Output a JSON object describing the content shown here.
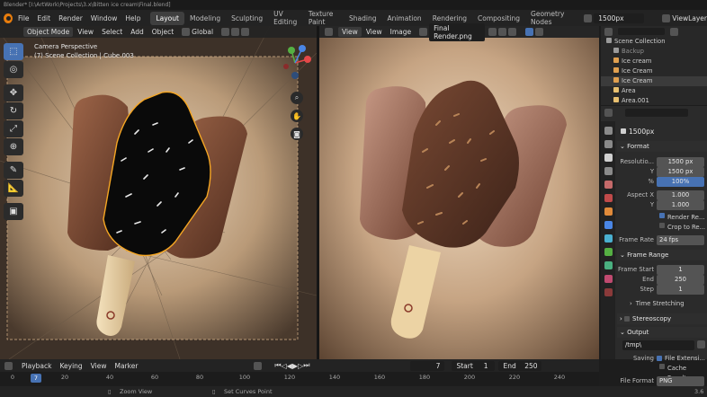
{
  "window": {
    "title": "Blender* [I:\\ArtWork\\Projects\\3.x\\Bitten ice cream\\Final.blend]"
  },
  "menu": [
    "File",
    "Edit",
    "Render",
    "Window",
    "Help"
  ],
  "workspaces": [
    "Layout",
    "Modeling",
    "Sculpting",
    "UV Editing",
    "Texture Paint",
    "Shading",
    "Animation",
    "Rendering",
    "Compositing",
    "Geometry Nodes"
  ],
  "active_workspace": "Layout",
  "scene": {
    "name": "1500px",
    "view_layer": "ViewLayer"
  },
  "viewport": {
    "mode": "Object Mode",
    "menus": [
      "View",
      "Select",
      "Add",
      "Object"
    ],
    "orientation": "Global",
    "info_line1": "Camera Perspective",
    "info_line2": "(7) Scene Collection | Cube.003"
  },
  "image_editor": {
    "menus": [
      "View",
      "Image"
    ],
    "view_dropdown": "View",
    "image_name": "Final Render.png"
  },
  "outliner": {
    "root": "Scene Collection",
    "items": [
      "Backup",
      "Ice cream",
      "Ice Cream",
      "Ice Cream",
      "Area",
      "Area.001"
    ]
  },
  "properties": {
    "data_name": "1500px",
    "format": {
      "title": "Format",
      "res_label": "Resolutio...",
      "res_x": "1500 px",
      "y_label": "Y",
      "res_y": "1500 px",
      "pct_label": "%",
      "pct": "100%",
      "aspect_label": "Aspect X",
      "aspect_x": "1.000",
      "aspect_y_label": "Y",
      "aspect_y": "1.000",
      "render_region": "Render Re...",
      "crop": "Crop to Re...",
      "fps_label": "Frame Rate",
      "fps": "24 fps"
    },
    "frame_range": {
      "title": "Frame Range",
      "start_label": "Frame Start",
      "start": "1",
      "end_label": "End",
      "end": "250",
      "step_label": "Step",
      "step": "1",
      "time_stretching": "Time Stretching",
      "stereoscopy": "Stereoscopy"
    },
    "output": {
      "title": "Output",
      "path": "/tmp\\",
      "saving_label": "Saving",
      "file_ext": "File Extensi...",
      "cache": "Cache Result",
      "format_label": "File Format",
      "format": "PNG"
    }
  },
  "timeline": {
    "menus": [
      "Playback",
      "Keying",
      "View",
      "Marker"
    ],
    "current_frame": "7",
    "start_label": "Start",
    "start": "1",
    "end_label": "End",
    "end": "250",
    "ticks": [
      "0",
      "20",
      "40",
      "60",
      "80",
      "100",
      "120",
      "140",
      "160",
      "180",
      "200",
      "220",
      "240"
    ],
    "playhead": "7"
  },
  "status": {
    "zoom": "Zoom View",
    "curves": "Set Curves Point",
    "version": "3.6"
  },
  "colors": {
    "accent": "#4772b3",
    "blender_orange": "#e87d0d",
    "selection": "#f5a623"
  }
}
